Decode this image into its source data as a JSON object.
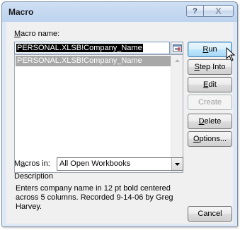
{
  "window": {
    "title": "Macro",
    "help_glyph": "?",
    "close_glyph": "X"
  },
  "macro_name": {
    "label_prefix": "",
    "label_accel": "M",
    "label_rest": "acro name:",
    "value": "PERSONAL.XLSB!Company_Name"
  },
  "macro_list": {
    "items": [
      "PERSONAL.XLSB!Company_Name"
    ],
    "selected_index": 0
  },
  "buttons": {
    "run": {
      "accel": "R",
      "rest": "un"
    },
    "step_into": {
      "accel": "S",
      "rest": "tep Into"
    },
    "edit": {
      "accel": "E",
      "rest": "dit"
    },
    "create": {
      "label": "Create"
    },
    "delete": {
      "accel": "D",
      "rest": "elete"
    },
    "options": {
      "accel": "O",
      "rest": "ptions..."
    },
    "cancel": {
      "label": "Cancel"
    }
  },
  "macros_in": {
    "label_prefix": "M",
    "label_accel": "a",
    "label_rest": "cros in:",
    "selected": "All Open Workbooks"
  },
  "description": {
    "label": "Description",
    "text": "Enters company name in 12 pt bold centered across 5 columns. Recorded 9-14-06 by Greg Harvey."
  },
  "icons": {
    "help": "help-icon",
    "close": "close-icon",
    "collapse_dialog": "collapse-dialog-icon",
    "scroll_up": "scroll-up-arrow-icon",
    "scroll_down": "scroll-down-arrow-icon",
    "dropdown": "dropdown-arrow-icon",
    "cursor": "mouse-pointer-icon"
  },
  "colors": {
    "title_gradient_top": "#cfe0f4",
    "dialog_face": "#f0f0f0",
    "selection": "#000000",
    "list_highlight": "#a8a8a8",
    "default_button_border": "#3c7fb1"
  }
}
